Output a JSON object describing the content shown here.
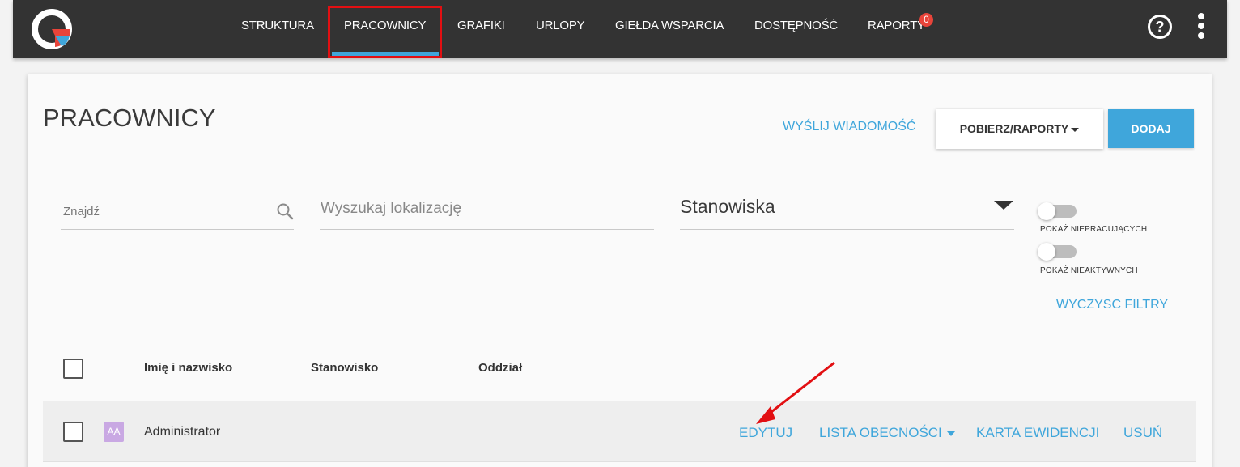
{
  "nav": {
    "items": [
      {
        "label": "STRUKTURA"
      },
      {
        "label": "PRACOWNICY"
      },
      {
        "label": "GRAFIKI"
      },
      {
        "label": "URLOPY"
      },
      {
        "label": "GIEŁDA WSPARCIA"
      },
      {
        "label": "DOSTĘPNOŚĆ"
      },
      {
        "label": "RAPORTY"
      }
    ],
    "active": "PRACOWNICY",
    "reports_badge": "0",
    "help_icon": "?"
  },
  "page": {
    "title": "PRACOWNICY",
    "send_message": "WYŚLIJ WIADOMOŚĆ",
    "reports_button": "POBIERZ/RAPORTY",
    "add_button": "DODAJ"
  },
  "filters": {
    "search_placeholder": "Znajdź",
    "location_placeholder": "Wyszukaj lokalizację",
    "positions_label": "Stanowiska",
    "toggle_non_working": "POKAŻ NIEPRACUJĄCYCH",
    "toggle_inactive": "POKAŻ NIEAKTYWNYCH",
    "clear_filters": "WYCZYSC FILTRY"
  },
  "table": {
    "headers": [
      "Imię i nazwisko",
      "Stanowisko",
      "Oddział"
    ],
    "rows": [
      {
        "avatar": "AA",
        "name": "Administrator",
        "actions": [
          "EDYTUJ",
          "LISTA OBECNOŚCI",
          "KARTA EWIDENCJI",
          "USUŃ"
        ]
      }
    ]
  },
  "colors": {
    "accent": "#3fa6db",
    "topbar": "#333333",
    "highlight": "#e20f12",
    "badge": "#e8443a",
    "avatar": "#c9a8e3"
  },
  "icons": {
    "logo": "app-logo",
    "search": "search-icon",
    "help": "help-icon",
    "more": "more-vertical-icon"
  }
}
